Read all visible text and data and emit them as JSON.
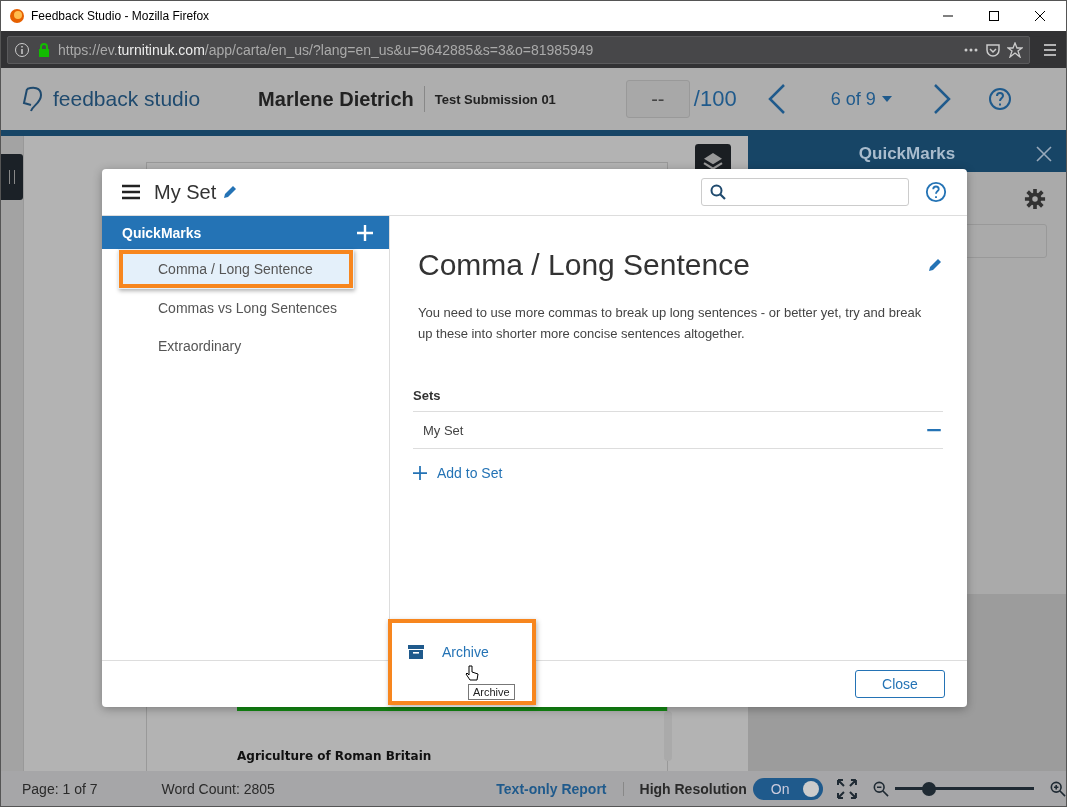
{
  "window": {
    "title": "Feedback Studio - Mozilla Firefox",
    "url_prefix": "https://ev.",
    "url_domain": "turnitinuk.com",
    "url_path": "/app/carta/en_us/?lang=en_us&u=9642885&s=3&o=81985949"
  },
  "header": {
    "brand": "feedback studio",
    "student": "Marlene Dietrich",
    "submission": "Test Submission 01",
    "grade_value": "--",
    "grade_total": "/100",
    "pager": "6 of 9"
  },
  "document": {
    "heading": "Agriculture of Roman Britain"
  },
  "side_panel": {
    "title": "QuickMarks"
  },
  "modal": {
    "set_name": "My Set",
    "list_title": "QuickMarks",
    "items": [
      {
        "label": "Comma / Long Sentence",
        "selected": true
      },
      {
        "label": "Commas vs Long Sentences",
        "selected": false
      },
      {
        "label": "Extraordinary",
        "selected": false
      }
    ],
    "detail": {
      "title": "Comma / Long Sentence",
      "description": "You need to use more commas to break up long sentences - or better yet, try and break up these into shorter more concise sentences altogether.",
      "sets_heading": "Sets",
      "sets": [
        "My Set"
      ],
      "add_to_set": "Add to Set"
    },
    "archive": "Archive",
    "tooltip": "Archive",
    "close": "Close"
  },
  "status_bar": {
    "page": "Page: 1 of 7",
    "word_count": "Word Count: 2805",
    "report_link": "Text-only Report",
    "resolution_label": "High Resolution",
    "resolution_toggle": {
      "label": "On",
      "on": true
    },
    "zoom": {
      "level": 0.25
    }
  }
}
